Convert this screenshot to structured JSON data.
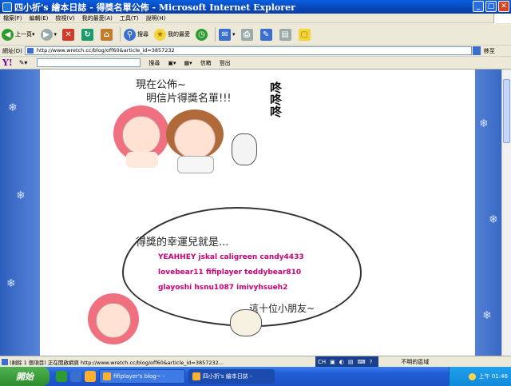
{
  "window": {
    "title": "四小折's 繪本日誌 - 得獎名單公佈 - Microsoft Internet Explorer"
  },
  "menu": [
    "檔案(F)",
    "編輯(E)",
    "檢視(V)",
    "我的最愛(A)",
    "工具(T)",
    "說明(H)"
  ],
  "toolbar": {
    "back_label": "上一頁",
    "search_label": "搜尋",
    "favorites_label": "我的最愛"
  },
  "address": {
    "label": "網址(D)",
    "url": "http://www.wretch.cc/blog/off60&article_id=3857232",
    "go_label": "移至"
  },
  "yahoo_bar": {
    "logo": "Y!",
    "search_label": "搜尋",
    "mail_label": "信箱",
    "logout_label": "登出"
  },
  "comic": {
    "top_line1": "現在公佈~",
    "top_line2": "明信片得獎名單!!!",
    "sfx": "咚咚咚",
    "bubble_title": "得獎的幸運兒就是...",
    "names_line1": "YEAHHEY jskal caligreen candy4433",
    "names_line2": "lovebear11 fifiplayer teddybear810",
    "names_line3": "glayoshi hsnu1087 imivyhsueh2",
    "bottom_text": "這十位小朋友~"
  },
  "status": {
    "text": "(剩餘 1 個項目) 正在開啟網頁 http://www.wretch.cc/blog/off60&article_id=3857232...",
    "ime": "CH",
    "zone": "不明的區域"
  },
  "taskbar": {
    "start_label": "開始",
    "tasks": [
      "fifiplayer's blog~ -",
      "四小折's 繪本日誌 -"
    ],
    "clock": "上午 01:46"
  }
}
